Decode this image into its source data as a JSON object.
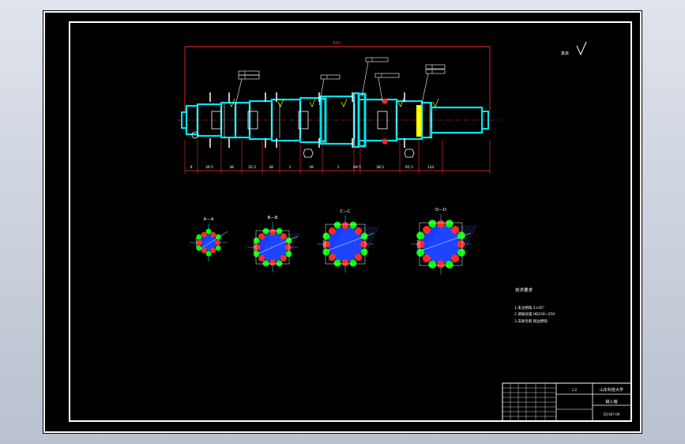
{
  "drawing": {
    "overall_length": "600",
    "roughness_note": "其余",
    "dims_bottom": [
      "9",
      "39.5",
      "38",
      "35.5",
      "38",
      "1",
      "39",
      "1",
      "89.5",
      "38.5",
      "65.5",
      "124"
    ],
    "section_labels": [
      "A—A",
      "B—B",
      "C—C",
      "D—D"
    ],
    "diameter_labels": [
      "φ44h6",
      "φ54h6",
      "φ64h6",
      "φ74h6"
    ],
    "tech_title": "技术要求",
    "tech_notes": [
      "1.未注倒角 2×45°",
      "2.调质处理 HB230~250",
      "3.去除毛刺 锐边倒钝"
    ],
    "title_block": {
      "school": "山东科技大学",
      "part_name": "输入轴",
      "scale": "1:2",
      "drawing_no": "LTJ-007-09"
    }
  },
  "colors": {
    "sheet": "#000000",
    "frame": "#ffffff",
    "shaft": "#00e5ee",
    "dimension": "#ff3030",
    "spline_outer": "#00ff00",
    "spline_inner": "#ff2a2a",
    "hatch": "#1a3cff",
    "highlight": "#ffff00"
  }
}
